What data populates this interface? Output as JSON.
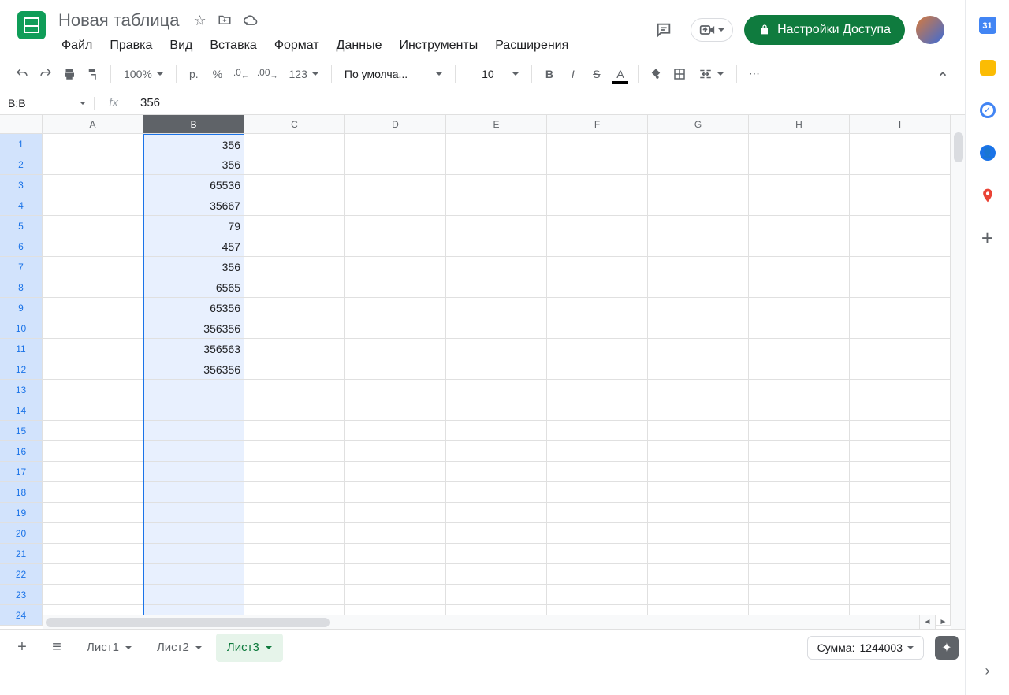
{
  "doc": {
    "title": "Новая таблица"
  },
  "menu": {
    "file": "Файл",
    "edit": "Правка",
    "view": "Вид",
    "insert": "Вставка",
    "format": "Формат",
    "data": "Данные",
    "tools": "Инструменты",
    "extensions": "Расширения"
  },
  "share": {
    "label": "Настройки Доступа"
  },
  "toolbar": {
    "zoom": "100%",
    "currency": "р.",
    "percent": "%",
    "dec_dec": ".0",
    "inc_dec": ".00",
    "num_format": "123",
    "font": "По умолча...",
    "font_size": "10"
  },
  "formula": {
    "name_box": "B:B",
    "value": "356"
  },
  "columns": [
    "A",
    "B",
    "C",
    "D",
    "E",
    "F",
    "G",
    "H",
    "I"
  ],
  "selected_column_index": 1,
  "row_count": 24,
  "cells": {
    "B1": "356",
    "B2": "356",
    "B3": "65536",
    "B4": "35667",
    "B5": "79",
    "B6": "457",
    "B7": "356",
    "B8": "6565",
    "B9": "65356",
    "B10": "356356",
    "B11": "356563",
    "B12": "356356"
  },
  "sheets": [
    {
      "name": "Лист1",
      "active": false
    },
    {
      "name": "Лист2",
      "active": false
    },
    {
      "name": "Лист3",
      "active": true
    }
  ],
  "summary": {
    "label": "Сумма:",
    "value": "1244003"
  },
  "sidepanel": {
    "cal_day": "31"
  }
}
